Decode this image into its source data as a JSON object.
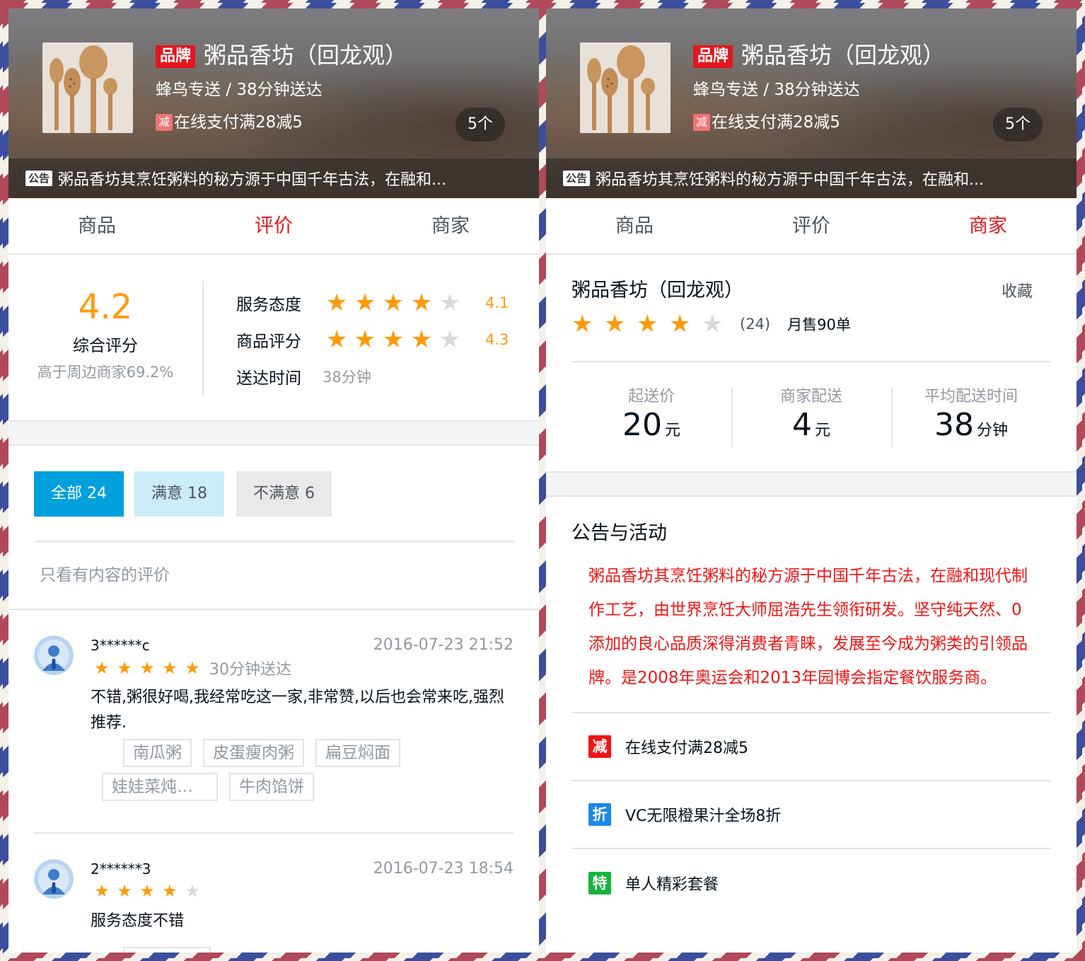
{
  "header": {
    "brand_tag": "品牌",
    "name": "粥品香坊（回龙观）",
    "delivery": "蜂鸟专送 / 38分钟送达",
    "promo_badge": "减",
    "promo_text": "在线支付满28减5",
    "count": "5个",
    "notice_tag": "公告",
    "notice_text": "粥品香坊其烹饪粥料的秘方源于中国千年古法，在融和..."
  },
  "tabs": {
    "goods": "商品",
    "ratings": "评价",
    "seller": "商家"
  },
  "ratings_page": {
    "score": "4.2",
    "score_label": "综合评分",
    "score_sub": "高于周边商家69.2%",
    "service_label": "服务态度",
    "service_score": "4.1",
    "service_stars": 4,
    "food_label": "商品评分",
    "food_score": "4.3",
    "food_stars": 4,
    "delivery_label": "送达时间",
    "delivery_time": "38分钟",
    "filter_all": "全部 24",
    "filter_positive": "满意 18",
    "filter_negative": "不满意 6",
    "only_content": "只看有内容的评价",
    "reviews": [
      {
        "username": "3******c",
        "date": "2016-07-23 21:52",
        "stars": 5,
        "delivery": "30分钟送达",
        "text": "不错,粥很好喝,我经常吃这一家,非常赞,以后也会常来吃,强烈推荐.",
        "tags": [
          "南瓜粥",
          "皮蛋瘦肉粥",
          "扁豆焖面",
          "娃娃菜炖…",
          "牛肉馅饼"
        ]
      },
      {
        "username": "2******3",
        "date": "2016-07-23 18:54",
        "stars": 4,
        "delivery": "",
        "text": "服务态度不错",
        "tags": [
          ""
        ]
      }
    ]
  },
  "seller_page": {
    "name": "粥品香坊（回龙观）",
    "favorite": "收藏",
    "stars": 4,
    "rating_count": "(24)",
    "sold": "月售90单",
    "min_price_label": "起送价",
    "min_price": "20",
    "min_price_unit": "元",
    "delivery_fee_label": "商家配送",
    "delivery_fee": "4",
    "delivery_fee_unit": "元",
    "avg_time_label": "平均配送时间",
    "avg_time": "38",
    "avg_time_unit": "分钟",
    "bulletin_title": "公告与活动",
    "bulletin": "粥品香坊其烹饪粥料的秘方源于中国千年古法，在融和现代制作工艺，由世界烹饪大师屈浩先生领衔研发。坚守纯天然、0添加的良心品质深得消费者青睐，发展至今成为粥类的引领品牌。是2008年奥运会和2013年园博会指定餐饮服务商。",
    "supports": [
      {
        "icon": "减",
        "text": "在线支付满28减5"
      },
      {
        "icon": "折",
        "text": "VC无限橙果汁全场8折"
      },
      {
        "icon": "特",
        "text": "单人精彩套餐"
      }
    ]
  },
  "colors": {
    "accent_red": "#e4161c",
    "star": "#ff9a0d",
    "filter_blue": "#00a0dc"
  }
}
